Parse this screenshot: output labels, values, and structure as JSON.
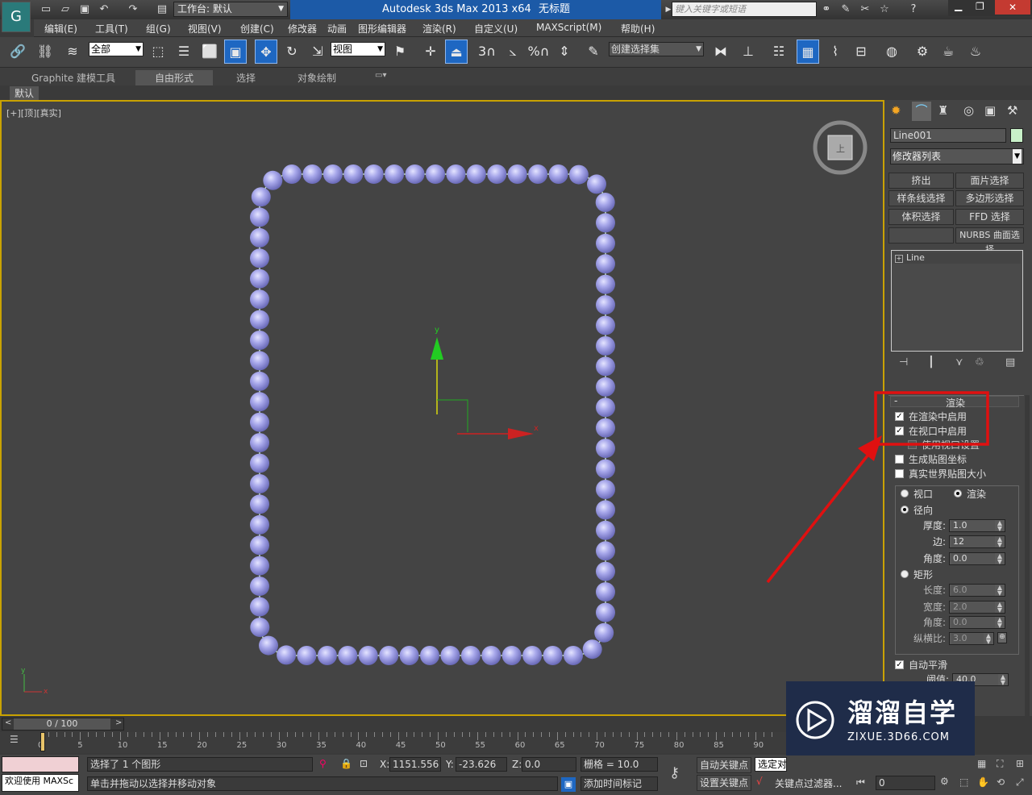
{
  "title": {
    "workspace_label": "工作台: 默认",
    "app": "Autodesk 3ds Max  2013 x64",
    "doc": "无标题",
    "search_placeholder": "键入关键字或短语"
  },
  "menu": [
    "编辑(E)",
    "工具(T)",
    "组(G)",
    "视图(V)",
    "创建(C)",
    "修改器",
    "动画",
    "图形编辑器",
    "渲染(R)",
    "自定义(U)",
    "MAXScript(M)",
    "帮助(H)"
  ],
  "toolbar": {
    "filter": "全部",
    "refsys": "视图",
    "selset": "创建选择集",
    "snap_3": "3",
    "snap_pct": "%"
  },
  "ribbon": {
    "tabs": [
      "Graphite 建模工具",
      "自由形式",
      "选择",
      "对象绘制"
    ],
    "sub": "默认"
  },
  "viewport": {
    "label": "[+][顶][真实]",
    "axis_x": "x",
    "axis_y": "y",
    "beads": 78,
    "bead_color": "#a7a7ea"
  },
  "cmd": {
    "object_name": "Line001",
    "object_color": "#c8f0c8",
    "modifier_list": "修改器列表",
    "buttons": [
      "挤出",
      "面片选择",
      "样条线选择",
      "多边形选择",
      "体积选择",
      "FFD 选择",
      "",
      "NURBS 曲面选择"
    ],
    "stack_item": "Line",
    "rollout_title": "渲染",
    "enable_render": "在渲染中启用",
    "enable_viewport": "在视口中启用",
    "use_viewport_settings": "使用视口设置",
    "gen_mapping": "生成贴图坐标",
    "real_world": "真实世界贴图大小",
    "radio_viewport": "视口",
    "radio_render": "渲染",
    "radial": "径向",
    "thickness_lbl": "厚度:",
    "thickness": "1.0",
    "sides_lbl": "边:",
    "sides": "12",
    "angle_lbl": "角度:",
    "angle": "0.0",
    "rect": "矩形",
    "length_lbl": "长度:",
    "length": "6.0",
    "width_lbl": "宽度:",
    "width": "2.0",
    "angle2_lbl": "角度:",
    "angle2": "0.0",
    "aspect_lbl": "纵横比:",
    "aspect": "3.0",
    "autosmooth": "自动平滑",
    "threshold_lbl": "阈值:",
    "threshold": "40.0"
  },
  "timeline": {
    "frame": "0 / 100",
    "ticks": [
      "0",
      "5",
      "10",
      "15",
      "20",
      "25",
      "30",
      "35",
      "40",
      "45",
      "50",
      "55",
      "60",
      "65",
      "70",
      "75",
      "80",
      "85",
      "90"
    ]
  },
  "status": {
    "welcome": "欢迎使用 MAXSc",
    "selected": "选择了 1 个图形",
    "x_lbl": "X:",
    "x": "1151.556",
    "y_lbl": "Y:",
    "y": "-23.626",
    "z_lbl": "Z:",
    "z": "0.0",
    "grid": "栅格 = 10.0",
    "autokey": "自动关键点",
    "selected_obj": "选定对",
    "setkey": "设置关键点",
    "keyfilter": "关键点过滤器...",
    "prompt": "单击并拖动以选择并移动对象",
    "add_time_tag": "添加时间标记",
    "frame_field": "0"
  },
  "watermark": {
    "brand": "溜溜自学",
    "url": "ZIXUE.3D66.COM"
  },
  "annotation_color": "#e01010"
}
